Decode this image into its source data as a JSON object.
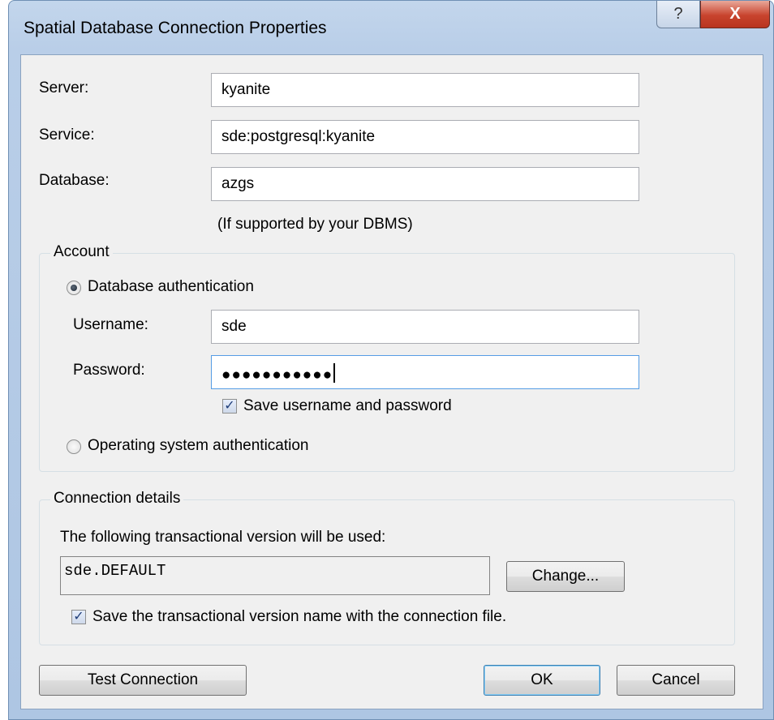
{
  "window": {
    "title": "Spatial Database Connection Properties",
    "help_glyph": "?",
    "close_glyph": "X"
  },
  "fields": {
    "server": {
      "label": "Server:",
      "value": "kyanite"
    },
    "service": {
      "label": "Service:",
      "value": "sde:postgresql:kyanite"
    },
    "database": {
      "label": "Database:",
      "value": "azgs",
      "note": "(If supported by your DBMS)"
    }
  },
  "account": {
    "group_title": "Account",
    "db_auth_label": "Database authentication",
    "db_auth_selected": true,
    "username": {
      "label": "Username:",
      "value": "sde"
    },
    "password": {
      "label": "Password:",
      "value": "●●●●●●●●●●●"
    },
    "save_credentials_label": "Save username and password",
    "save_credentials_checked": true,
    "os_auth_label": "Operating system authentication",
    "os_auth_selected": false
  },
  "connection_details": {
    "group_title": "Connection details",
    "description": "The following transactional version will be used:",
    "version_value": "sde.DEFAULT",
    "change_label": "Change...",
    "save_version_label": "Save the transactional version name with the connection file.",
    "save_version_checked": true
  },
  "buttons": {
    "test_connection": "Test Connection",
    "ok": "OK",
    "cancel": "Cancel"
  },
  "colors": {
    "title_bar": "#b9cee8",
    "dialog_bg": "#f0f0f0",
    "close_button": "#c8432d",
    "focus_border": "#569de5"
  },
  "icons": {
    "checkbox_glyph": "✓"
  }
}
